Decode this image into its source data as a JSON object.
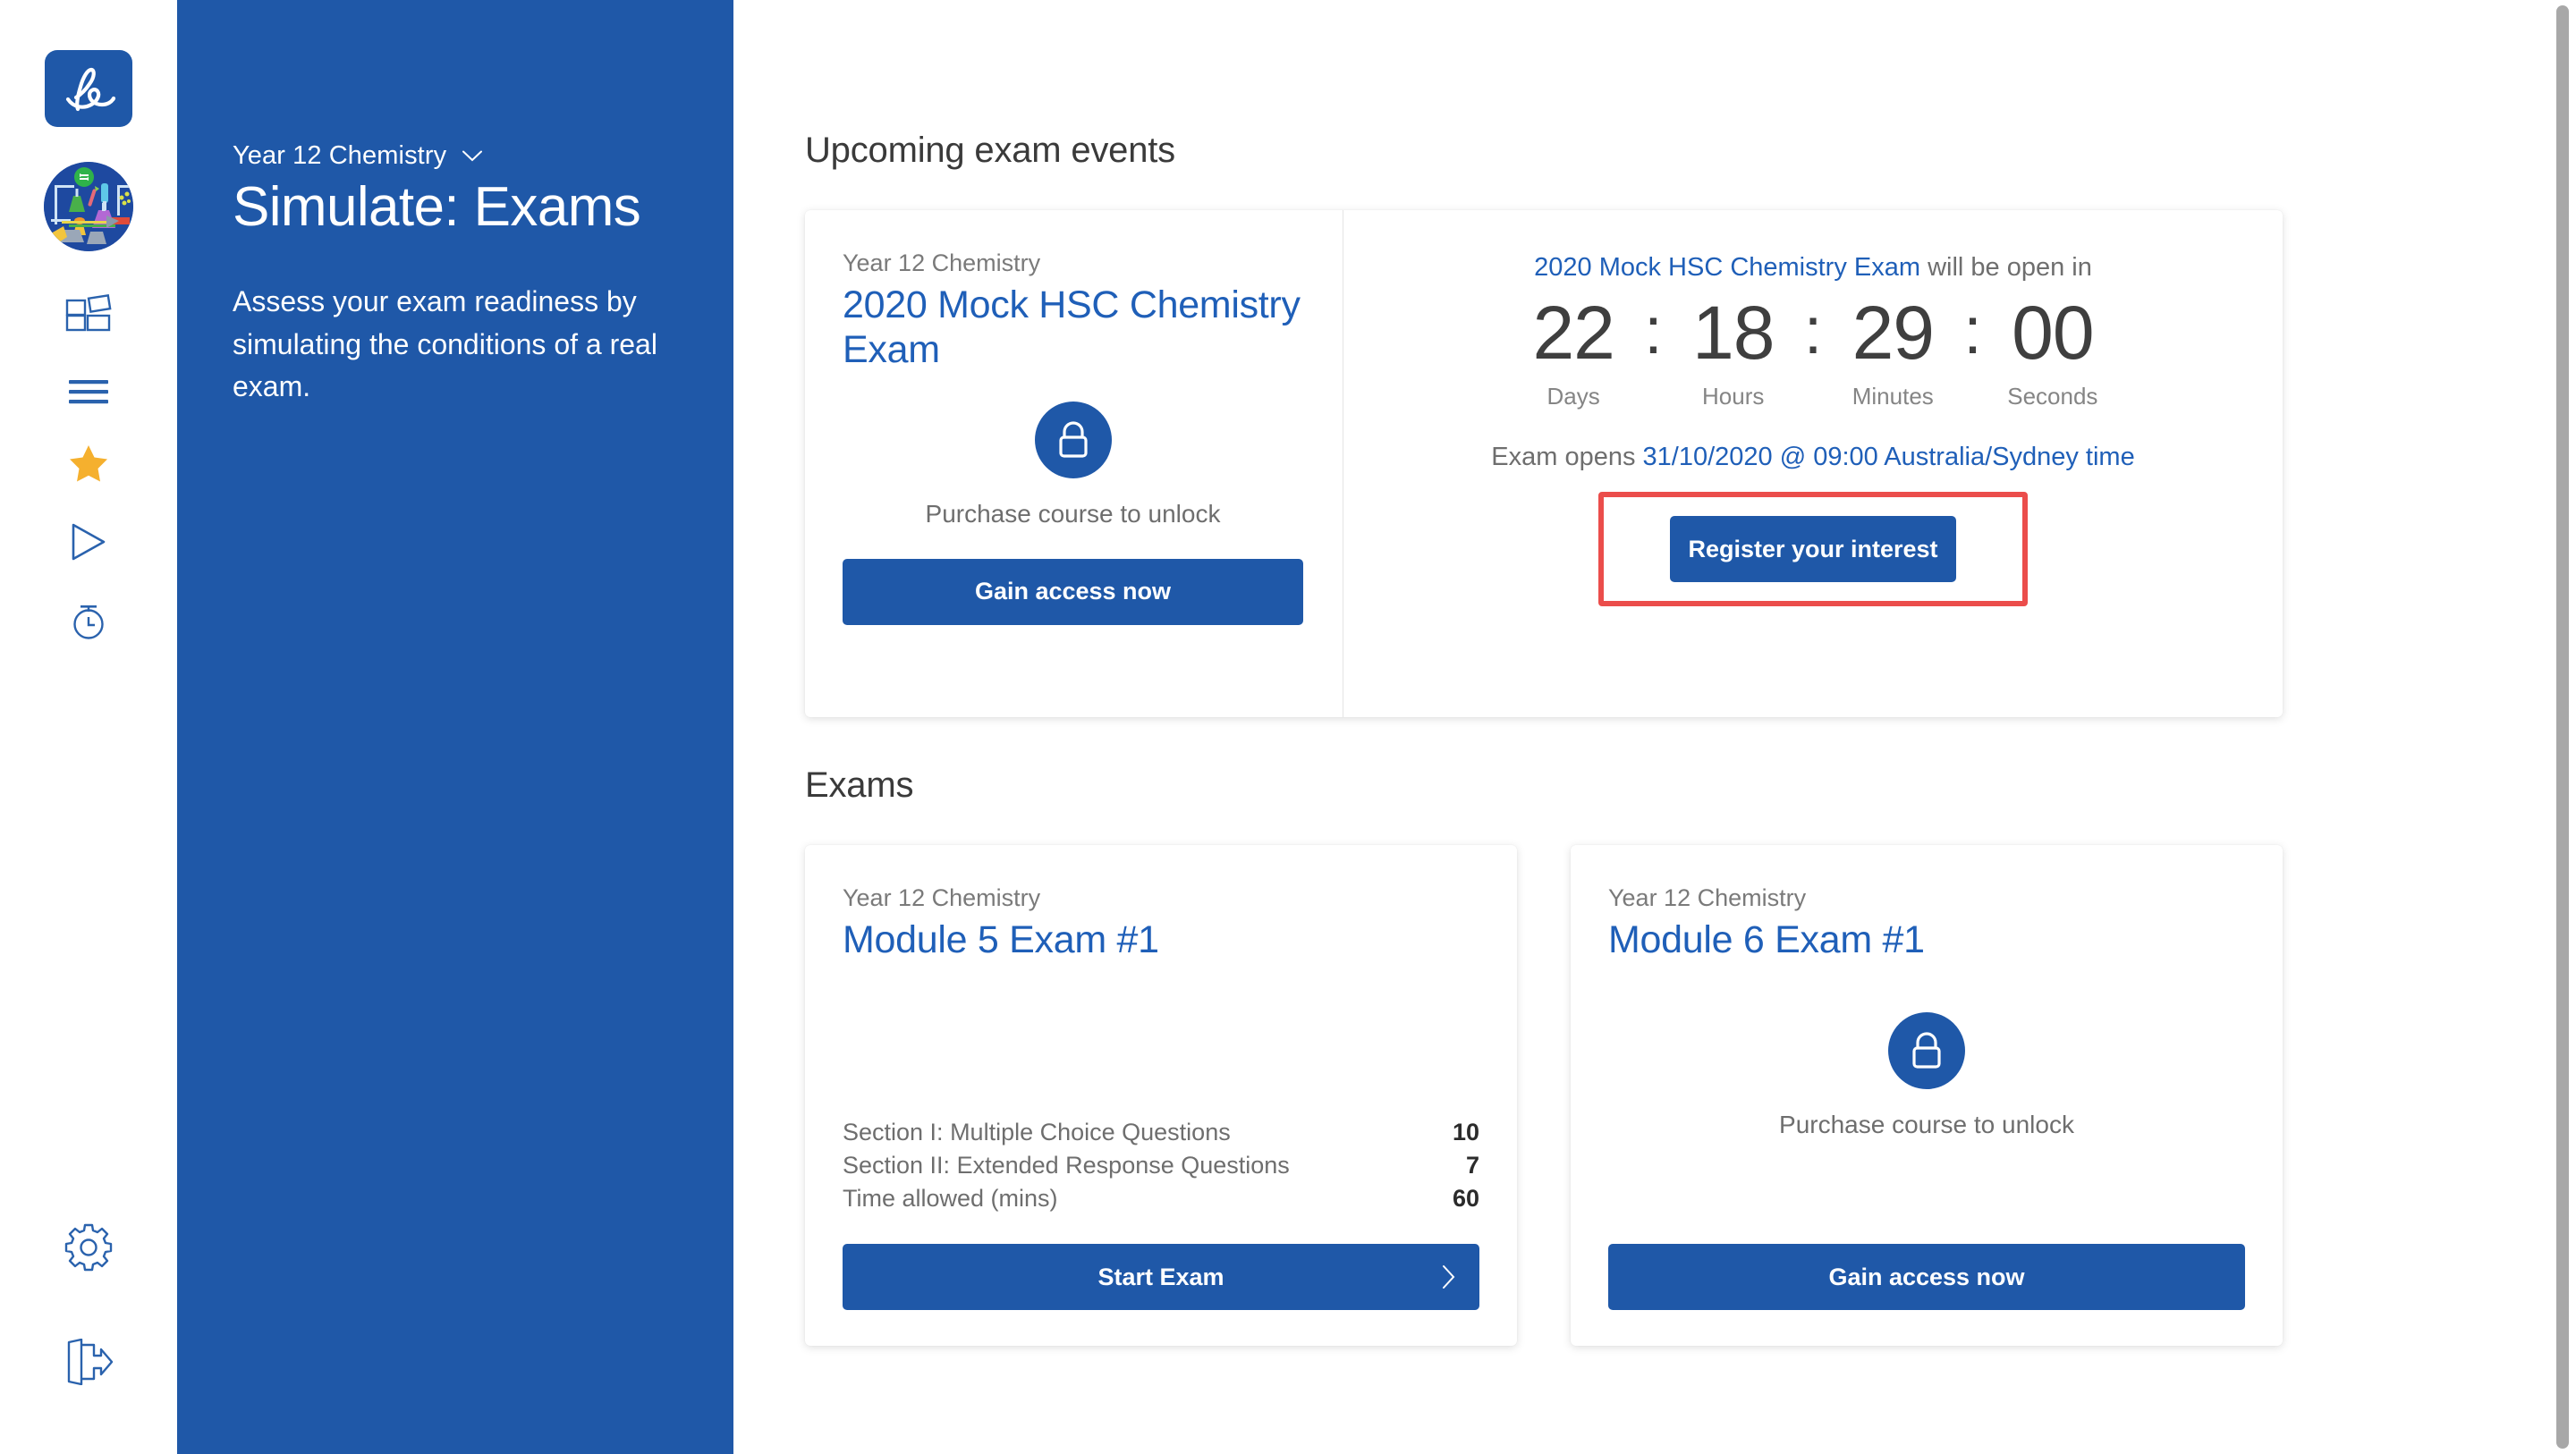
{
  "brand": {
    "logo_text": "le",
    "accent_blue": "#1f58a8",
    "link_blue": "#1f5fb8",
    "highlight_red": "#eb4d4b"
  },
  "rail": {
    "items": [
      {
        "name": "logo",
        "icon": "le-logo-icon",
        "label": "le"
      },
      {
        "name": "course-avatar",
        "icon": "chemistry-course-icon",
        "label": "Year 12 Chemistry"
      },
      {
        "name": "learn",
        "icon": "grid-blocks-icon",
        "label": "Learn"
      },
      {
        "name": "notes",
        "icon": "hamburger-lines-icon",
        "label": "Notes"
      },
      {
        "name": "favourites",
        "icon": "star-icon",
        "label": "Favourites"
      },
      {
        "name": "videos",
        "icon": "play-triangle-icon",
        "label": "Videos"
      },
      {
        "name": "exams",
        "icon": "clock-timer-icon",
        "label": "Exams"
      },
      {
        "name": "settings",
        "icon": "gear-icon",
        "label": "Settings"
      },
      {
        "name": "logout",
        "icon": "logout-door-icon",
        "label": "Log out"
      }
    ]
  },
  "context_panel": {
    "course": "Year 12 Chemistry",
    "course_chevron": "chevron-down-icon",
    "title": "Simulate: Exams",
    "description": "Assess your exam readiness by simulating the conditions of a real exam."
  },
  "main": {
    "upcoming_section_title": "Upcoming exam events",
    "exams_section_title": "Exams",
    "event_card": {
      "course": "Year 12 Chemistry",
      "title": "2020 Mock HSC Chemistry Exam",
      "lock_icon": "lock-icon",
      "lock_caption": "Purchase course to unlock",
      "cta_label": "Gain access now",
      "countdown_prefix_name": "2020 Mock HSC Chemistry Exam",
      "countdown_prefix_rest": " will be open in",
      "countdown": [
        {
          "value": "22",
          "label": "Days"
        },
        {
          "value": "18",
          "label": "Hours"
        },
        {
          "value": "29",
          "label": "Minutes"
        },
        {
          "value": "00",
          "label": "Seconds"
        }
      ],
      "separator": ":",
      "opens_prefix": "Exam opens ",
      "opens_when": "31/10/2020 @ 09:00 Australia/Sydney time",
      "register_label": "Register your interest"
    },
    "exam_cards": [
      {
        "course": "Year 12 Chemistry",
        "title": "Module 5 Exam #1",
        "locked": false,
        "specs": [
          {
            "label": "Section I: Multiple Choice Questions",
            "value": "10"
          },
          {
            "label": "Section II: Extended Response Questions",
            "value": "7"
          },
          {
            "label": "Time allowed (mins)",
            "value": "60"
          }
        ],
        "cta_label": "Start Exam",
        "cta_icon": "chevron-right-icon"
      },
      {
        "course": "Year 12 Chemistry",
        "title": "Module 6 Exam #1",
        "locked": true,
        "lock_icon": "lock-icon",
        "lock_caption": "Purchase course to unlock",
        "cta_label": "Gain access now"
      }
    ]
  }
}
